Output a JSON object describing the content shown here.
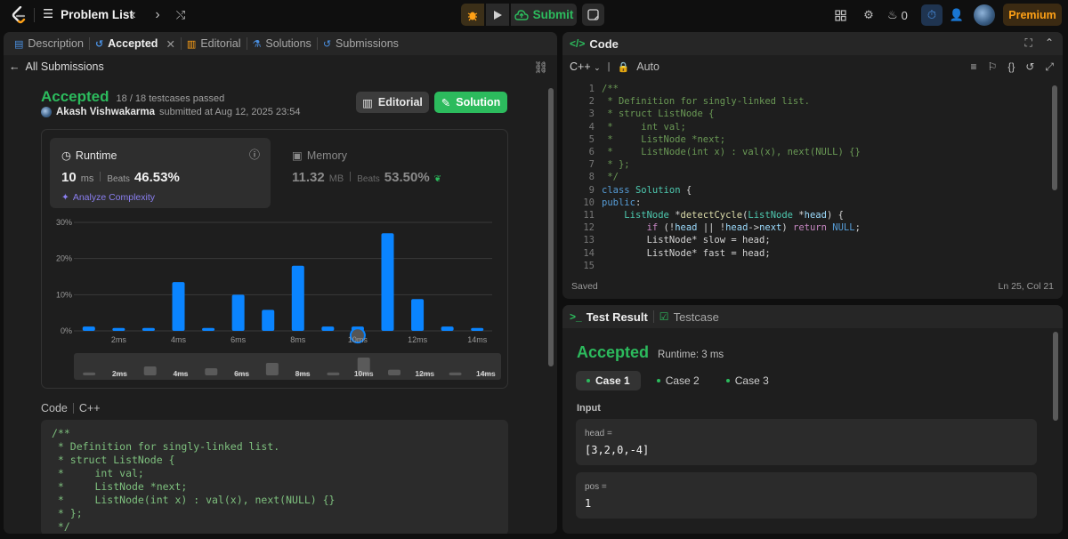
{
  "topbar": {
    "problem_list": "Problem List",
    "submit": "Submit",
    "streak": "0",
    "premium": "Premium"
  },
  "left_tabs": [
    {
      "label": "Description"
    },
    {
      "label": "Accepted"
    },
    {
      "label": "Editorial"
    },
    {
      "label": "Solutions"
    },
    {
      "label": "Submissions"
    }
  ],
  "submission": {
    "back_label": "All Submissions",
    "status": "Accepted",
    "testcases": "18 / 18 testcases passed",
    "author": "Akash Vishwakarma",
    "submitted_text": "submitted at Aug 12, 2025 23:54",
    "editorial_btn": "Editorial",
    "solution_btn": "Solution"
  },
  "runtime": {
    "title": "Runtime",
    "value": "10",
    "unit": "ms",
    "beats_label": "Beats",
    "beats": "46.53%",
    "analyze": "Analyze Complexity"
  },
  "memory": {
    "title": "Memory",
    "value": "11.32",
    "unit": "MB",
    "beats_label": "Beats",
    "beats": "53.50%"
  },
  "chart_data": {
    "type": "bar",
    "x": [
      1,
      2,
      3,
      4,
      5,
      6,
      7,
      8,
      9,
      10,
      11,
      12,
      13,
      14
    ],
    "values": [
      1.2,
      0.8,
      0.8,
      13.5,
      0.8,
      10,
      5.8,
      18,
      1.2,
      1.2,
      27,
      8.8,
      1.2,
      0.8
    ],
    "highlight_x": 10,
    "xticks": [
      "2ms",
      "4ms",
      "6ms",
      "8ms",
      "10ms",
      "12ms",
      "14ms"
    ],
    "yticks": [
      "0%",
      "10%",
      "20%",
      "30%"
    ],
    "ylim": [
      0,
      30
    ],
    "grid": true,
    "bar_color": "#0a84ff",
    "navigator_values": [
      0.8,
      0.8,
      2.5,
      0.8,
      2,
      0.8,
      3.5,
      0.8,
      0.8,
      5,
      1.6,
      0.8,
      0.8,
      0.8
    ],
    "navigator_xticks": [
      "2ms",
      "4ms",
      "6ms",
      "8ms",
      "10ms",
      "12ms",
      "14ms"
    ]
  },
  "code_section": {
    "label": "Code",
    "lang": "C++",
    "lines": [
      "/**",
      " * Definition for singly-linked list.",
      " * struct ListNode {",
      " *     int val;",
      " *     ListNode *next;",
      " *     ListNode(int x) : val(x), next(NULL) {}",
      " * };",
      " */"
    ]
  },
  "editor": {
    "title": "Code",
    "lang": "C++",
    "mode": "Auto",
    "line_numbers": [
      "1",
      "2",
      "3",
      "4",
      "5",
      "6",
      "7",
      "8",
      "9",
      "10",
      "11",
      "12",
      "13",
      "14",
      "15"
    ],
    "saved": "Saved",
    "cursor": "Ln 25, Col 21"
  },
  "test_result": {
    "tab1": "Test Result",
    "tab2": "Testcase",
    "status": "Accepted",
    "runtime": "Runtime: 3 ms",
    "cases": [
      "Case 1",
      "Case 2",
      "Case 3"
    ],
    "input_label": "Input",
    "inputs": [
      {
        "name": "head =",
        "value": "[3,2,0,-4]"
      },
      {
        "name": "pos =",
        "value": "1"
      }
    ]
  },
  "colors": {
    "accent_green": "#2cbb5d",
    "bar_blue": "#0a84ff",
    "premium_orange": "#ffa116"
  }
}
